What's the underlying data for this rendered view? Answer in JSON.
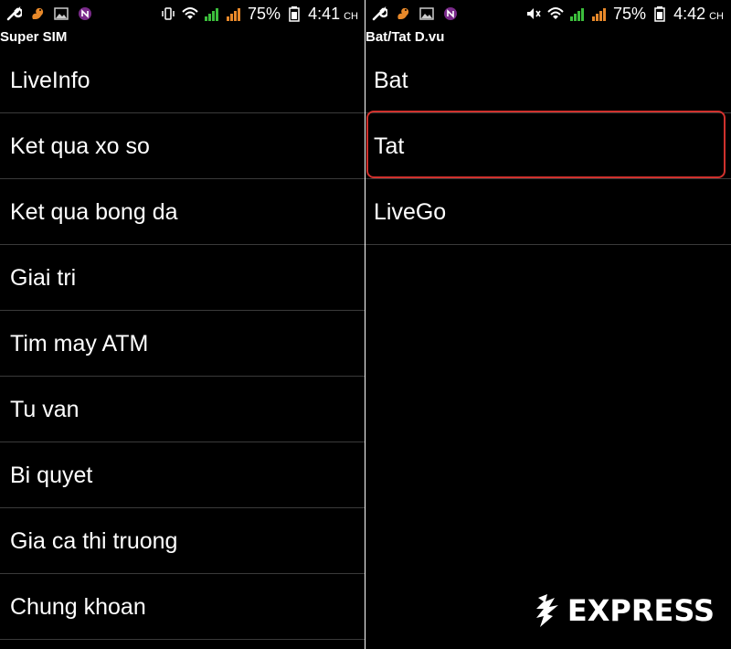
{
  "left": {
    "status": {
      "battery_percent": "75%",
      "time": "4:41",
      "ampm": "CH"
    },
    "title": "Super SIM",
    "items": [
      {
        "label": "LiveInfo"
      },
      {
        "label": "Ket qua xo so"
      },
      {
        "label": "Ket qua bong da"
      },
      {
        "label": "Giai tri"
      },
      {
        "label": "Tim may ATM"
      },
      {
        "label": "Tu van"
      },
      {
        "label": "Bi quyet"
      },
      {
        "label": "Gia ca thi truong"
      },
      {
        "label": "Chung khoan"
      }
    ]
  },
  "right": {
    "status": {
      "battery_percent": "75%",
      "time": "4:42",
      "ampm": "CH"
    },
    "title": "Bat/Tat D.vu",
    "items": [
      {
        "label": "Bat"
      },
      {
        "label": "Tat",
        "highlighted": true
      },
      {
        "label": "LiveGo"
      }
    ]
  },
  "watermark": {
    "text": "EXPRESS"
  },
  "colors": {
    "highlight_border": "#d0312d",
    "signal_green": "#3cbf3c",
    "signal_orange": "#e8892a"
  },
  "icons": [
    "wrench-icon",
    "squirrel-icon",
    "image-icon",
    "onenote-icon",
    "vibrate-icon",
    "mute-icon",
    "wifi-icon",
    "signal-icon",
    "battery-icon"
  ]
}
